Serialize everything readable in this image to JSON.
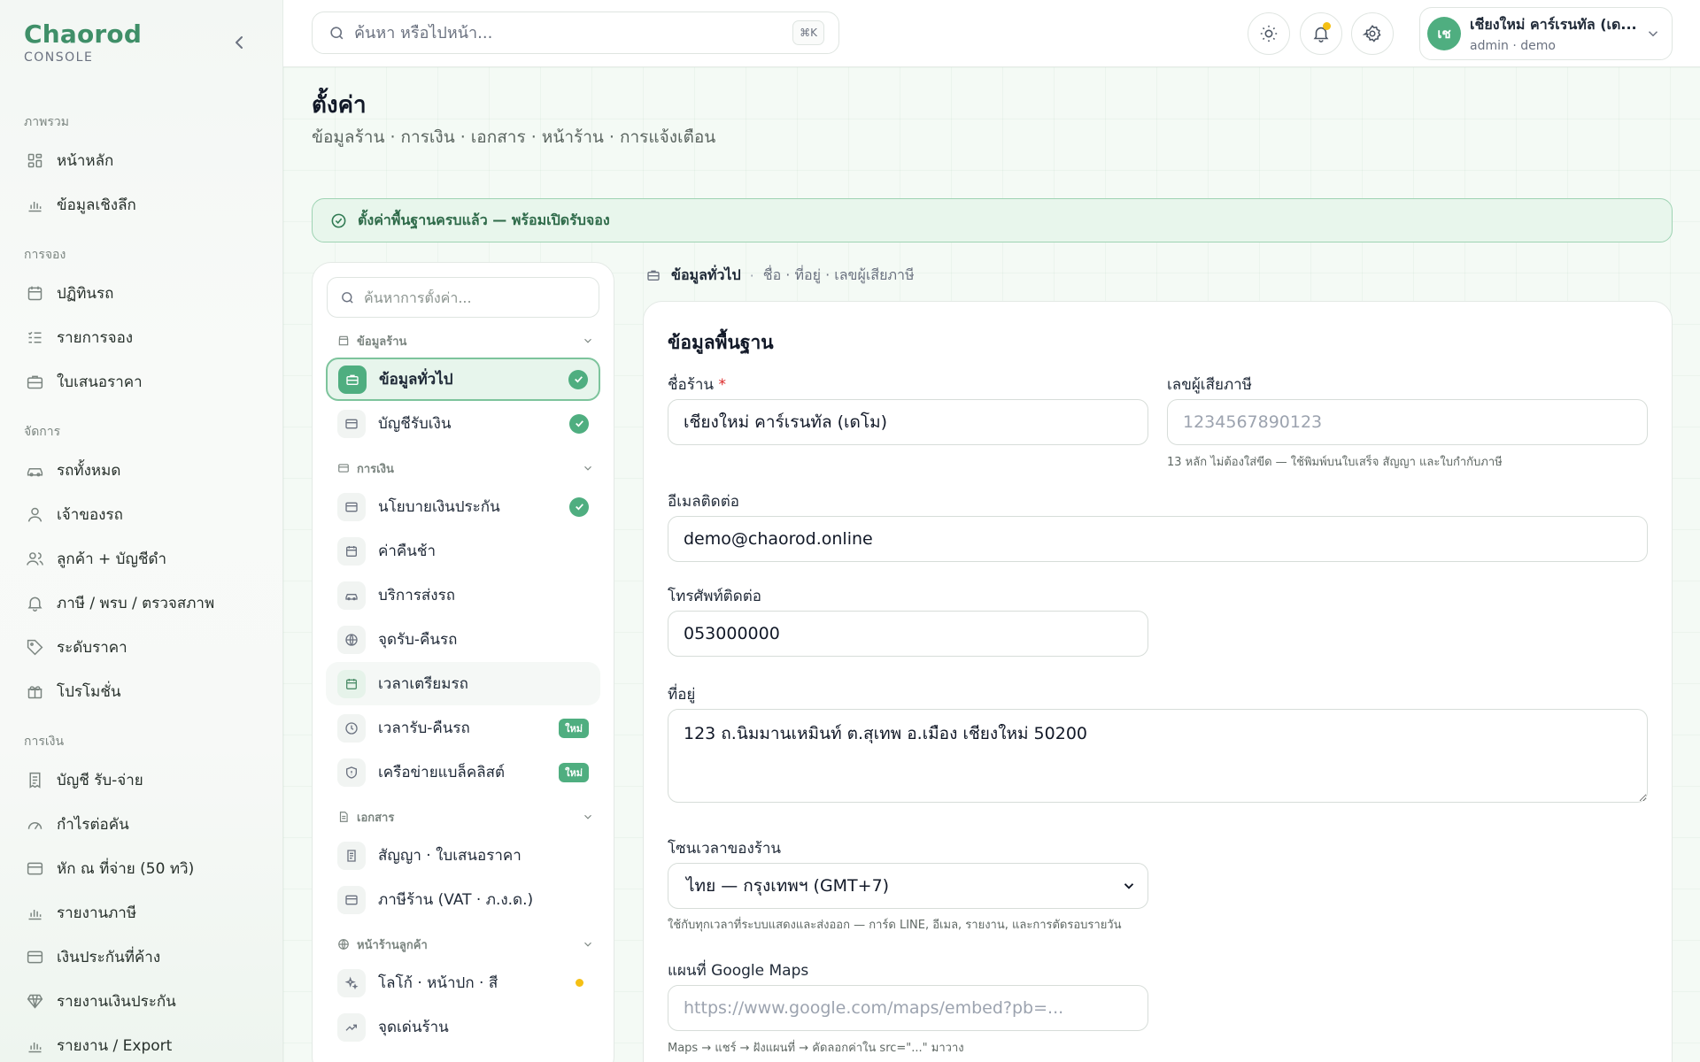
{
  "brand": {
    "name": "Chaorod",
    "sub": "CONSOLE"
  },
  "sidebar": {
    "sections": [
      {
        "title": "ภาพรวม",
        "items": [
          {
            "label": "หน้าหลัก",
            "icon": "grid-icon"
          },
          {
            "label": "ข้อมูลเชิงลึก",
            "icon": "bar-chart-icon"
          }
        ]
      },
      {
        "title": "การจอง",
        "items": [
          {
            "label": "ปฏิทินรถ",
            "icon": "calendar-icon"
          },
          {
            "label": "รายการจอง",
            "icon": "list-icon"
          },
          {
            "label": "ใบเสนอราคา",
            "icon": "briefcase-icon"
          }
        ]
      },
      {
        "title": "จัดการ",
        "items": [
          {
            "label": "รถทั้งหมด",
            "icon": "car-icon"
          },
          {
            "label": "เจ้าของรถ",
            "icon": "user-icon"
          },
          {
            "label": "ลูกค้า + บัญชีดำ",
            "icon": "users-icon"
          },
          {
            "label": "ภาษี / พรบ / ตรวจสภาพ",
            "icon": "bell-icon"
          },
          {
            "label": "ระดับราคา",
            "icon": "tag-icon"
          },
          {
            "label": "โปรโมชั่น",
            "icon": "gift-icon"
          }
        ]
      },
      {
        "title": "การเงิน",
        "items": [
          {
            "label": "บัญชี รับ-จ่าย",
            "icon": "receipt-icon"
          },
          {
            "label": "กำไรต่อคัน",
            "icon": "gauge-icon"
          },
          {
            "label": "หัก ณ ที่จ่าย (50 ทวิ)",
            "icon": "card-icon"
          },
          {
            "label": "รายงานภาษี",
            "icon": "bar-chart-icon"
          },
          {
            "label": "เงินประกันที่ค้าง",
            "icon": "card-icon"
          },
          {
            "label": "รายงานเงินประกัน",
            "icon": "diamond-icon"
          },
          {
            "label": "รายงาน / Export",
            "icon": "bar-chart-icon"
          }
        ]
      }
    ]
  },
  "topbar": {
    "search_placeholder": "ค้นหา หรือไปหน้า...",
    "shortcut": "⌘K",
    "account": {
      "initials": "เช",
      "name": "เชียงใหม่ คาร์เรนทัล (เด...",
      "role": "admin · demo"
    }
  },
  "page": {
    "title": "ตั้งค่า",
    "subtitle": "ข้อมูลร้าน · การเงิน · เอกสาร · หน้าร้าน · การแจ้งเตือน",
    "banner": "ตั้งค่าพื้นฐานครบแล้ว — พร้อมเปิดรับจอง"
  },
  "settings_nav": {
    "search_placeholder": "ค้นหาการตั้งค่า...",
    "groups": [
      {
        "title": "ข้อมูลร้าน",
        "items": [
          {
            "label": "ข้อมูลทั่วไป",
            "status": "done",
            "active": true
          },
          {
            "label": "บัญชีรับเงิน",
            "status": "done"
          }
        ]
      },
      {
        "title": "การเงิน",
        "items": [
          {
            "label": "นโยบายเงินประกัน",
            "status": "done"
          },
          {
            "label": "ค่าคืนช้า"
          },
          {
            "label": "บริการส่งรถ"
          },
          {
            "label": "จุดรับ-คืนรถ"
          },
          {
            "label": "เวลาเตรียมรถ"
          },
          {
            "label": "เวลารับ-คืนรถ",
            "badge": "ใหม่"
          },
          {
            "label": "เครือข่ายแบล็คลิสต์",
            "badge": "ใหม่"
          }
        ]
      },
      {
        "title": "เอกสาร",
        "items": [
          {
            "label": "สัญญา · ใบเสนอราคา"
          },
          {
            "label": "ภาษีร้าน (VAT · ภ.ง.ด.)"
          }
        ]
      },
      {
        "title": "หน้าร้านลูกค้า",
        "items": [
          {
            "label": "โลโก้ · หน้าปก · สี",
            "status": "pending"
          },
          {
            "label": "จุดเด่นร้าน"
          }
        ]
      }
    ]
  },
  "detail": {
    "breadcrumb": {
      "current": "ข้อมูลทั่วไป",
      "description": "ชื่อ · ที่อยู่ · เลขผู้เสียภาษี"
    },
    "card_title": "ข้อมูลพื้นฐาน",
    "fields": {
      "shop_name": {
        "label": "ชื่อร้าน",
        "required_mark": "*",
        "value": "เชียงใหม่ คาร์เรนทัล (เดโม)"
      },
      "tax_id": {
        "label": "เลขผู้เสียภาษี",
        "placeholder": "1234567890123",
        "hint": "13 หลัก ไม่ต้องใส่ขีด — ใช้พิมพ์บนใบเสร็จ สัญญา และใบกำกับภาษี"
      },
      "email": {
        "label": "อีเมลติดต่อ",
        "value": "demo@chaorod.online"
      },
      "phone": {
        "label": "โทรศัพท์ติดต่อ",
        "value": "053000000"
      },
      "address": {
        "label": "ที่อยู่",
        "value": "123 ถ.นิมมานเหมินท์ ต.สุเทพ อ.เมือง เชียงใหม่ 50200"
      },
      "timezone": {
        "label": "โซนเวลาของร้าน",
        "value": "ไทย — กรุงเทพฯ (GMT+7)",
        "hint": "ใช้กับทุกเวลาที่ระบบแสดงและส่งออก — การ์ด LINE, อีเมล, รายงาน, และการตัดรอบรายวัน"
      },
      "maps": {
        "label": "แผนที่ Google Maps",
        "placeholder": "https://www.google.com/maps/embed?pb=...",
        "hint": "Maps → แชร์ → ฝังแผนที่ → คัดลอกค่าใน src=\"...\" มาวาง"
      }
    }
  },
  "colors": {
    "brand": "#3f8f68",
    "accent": "#4fae80",
    "banner_bg": "#e8f6ec",
    "warning_dot": "#f5c014"
  }
}
